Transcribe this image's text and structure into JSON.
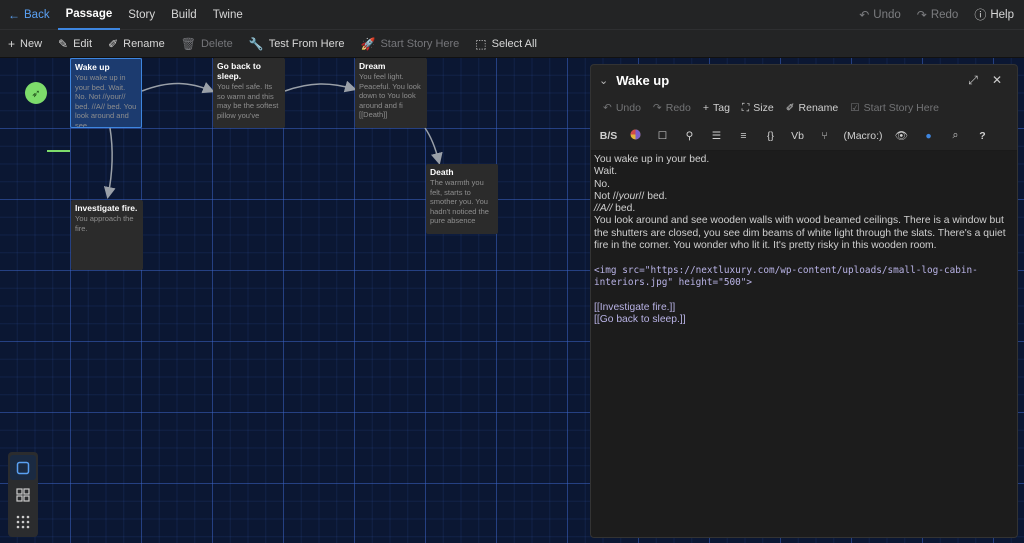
{
  "topbar": {
    "back": "Back",
    "tabs": [
      "Passage",
      "Story",
      "Build",
      "Twine"
    ],
    "undo": "Undo",
    "redo": "Redo",
    "help": "Help"
  },
  "toolbar": {
    "new": "New",
    "edit": "Edit",
    "rename": "Rename",
    "delete": "Delete",
    "test_from_here": "Test From Here",
    "start_story_here": "Start Story Here",
    "select_all": "Select All"
  },
  "passages": [
    {
      "id": "wake-up",
      "title": "Wake up",
      "body": "You wake up in your bed. Wait. No. Not //your// bed. //A// bed. You look around and see"
    },
    {
      "id": "go-back",
      "title": "Go back to sleep.",
      "body": "You feel safe. Its so warm and this may be the softest pillow you've"
    },
    {
      "id": "dream",
      "title": "Dream",
      "body": "You feel light. Peaceful. You look down to You look around and fi [[Death]]"
    },
    {
      "id": "death",
      "title": "Death",
      "body": "The warmth you felt, starts to smother you. You hadn't noticed the pure absence"
    },
    {
      "id": "investigate",
      "title": "Investigate fire.",
      "body": "You approach the fire."
    }
  ],
  "dialog": {
    "title": "Wake up",
    "undo": "Undo",
    "redo": "Redo",
    "tag": "Tag",
    "size": "Size",
    "rename": "Rename",
    "start_story_here": "Start Story Here",
    "macro": "(Macro:)",
    "format_b": "B/S",
    "format_vb": "Vb",
    "format_braces": "{}",
    "format_help": "?"
  },
  "editor_lines": {
    "l1": "You wake up in your bed.",
    "l2": "Wait.",
    "l3": "No.",
    "l4a": "Not //",
    "l4b": "your",
    "l4c": "// bed.",
    "l5a": "//A//",
    "l5b": " bed.",
    "l6": "You look around and see wooden walls with wood beamed ceilings. There is a window but the shutters are closed, you see dim beams of white light through the slats. There's a quiet fire in the corner. You wonder who lit it. It's pretty risky in this wooden room.",
    "l7": "<img src=\"https://nextluxury.com/wp-content/uploads/small-log-cabin-interiors.jpg\" height=\"500\">",
    "l8": "[[Investigate fire.]]",
    "l9": "[[Go back to sleep.]]"
  },
  "colors": {
    "accent": "#3e86e0",
    "start": "#7ddc6b",
    "canvas": "#0b1733",
    "panel": "#242424"
  }
}
